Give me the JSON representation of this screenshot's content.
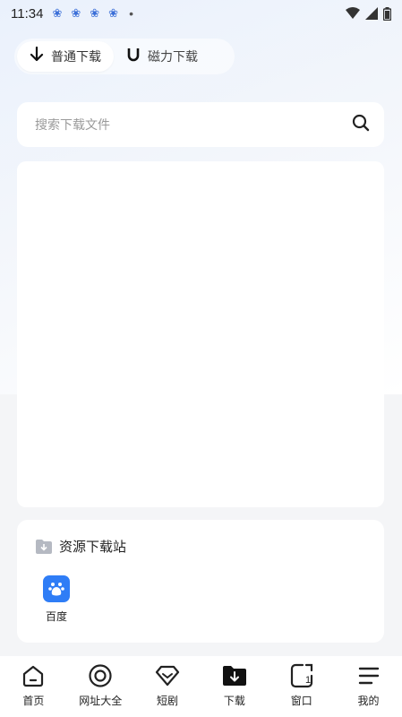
{
  "status_bar": {
    "time": "11:34",
    "notification_icons": [
      "baidu-paw-icon",
      "baidu-paw-icon",
      "baidu-paw-icon",
      "baidu-paw-icon"
    ],
    "more_dot": "•"
  },
  "mode_tabs": [
    {
      "label": "普通下载",
      "icon": "download-arrow-icon",
      "active": true
    },
    {
      "label": "磁力下载",
      "icon": "magnet-icon",
      "active": false
    }
  ],
  "search": {
    "placeholder": "搜索下载文件"
  },
  "resource_section": {
    "title": "资源下载站",
    "sites": [
      {
        "label": "百度",
        "icon": "baidu-paw-icon"
      }
    ]
  },
  "bottom_nav": [
    {
      "label": "首页",
      "icon": "home-icon"
    },
    {
      "label": "网址大全",
      "icon": "target-icon"
    },
    {
      "label": "短剧",
      "icon": "diamond-icon"
    },
    {
      "label": "下载",
      "icon": "download-folder-icon",
      "active": true
    },
    {
      "label": "窗口",
      "icon": "window-icon",
      "badge": "1"
    },
    {
      "label": "我的",
      "icon": "menu-icon"
    }
  ],
  "colors": {
    "accent": "#2f7df6",
    "paw": "#3b6fd8"
  }
}
